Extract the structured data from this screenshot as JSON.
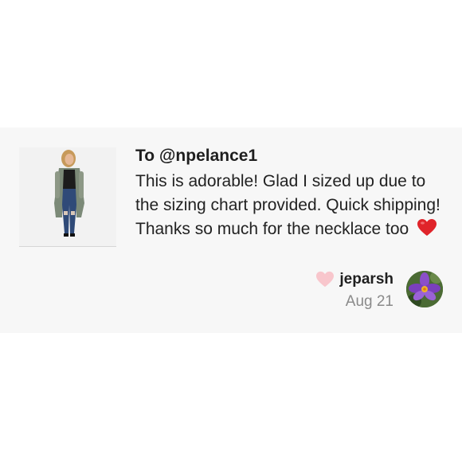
{
  "review": {
    "recipient": "To @npelance1",
    "text": "This is adorable! Glad I sized up due to the sizing chart provided. Quick shipping! Thanks so much for the necklace too",
    "emoji_icon": "red-heart-icon",
    "author": {
      "username": "jeparsh",
      "date": "Aug 21",
      "like_icon": "pink-heart-icon",
      "avatar_icon": "purple-crocus-flower-avatar"
    },
    "product_image_icon": "product-photo-model-jeans-cardigan"
  },
  "colors": {
    "card_background": "#f7f7f7",
    "heart_red": "#e0242a",
    "heart_pink": "#f8c6cc",
    "date_gray": "#8a8a8a"
  }
}
